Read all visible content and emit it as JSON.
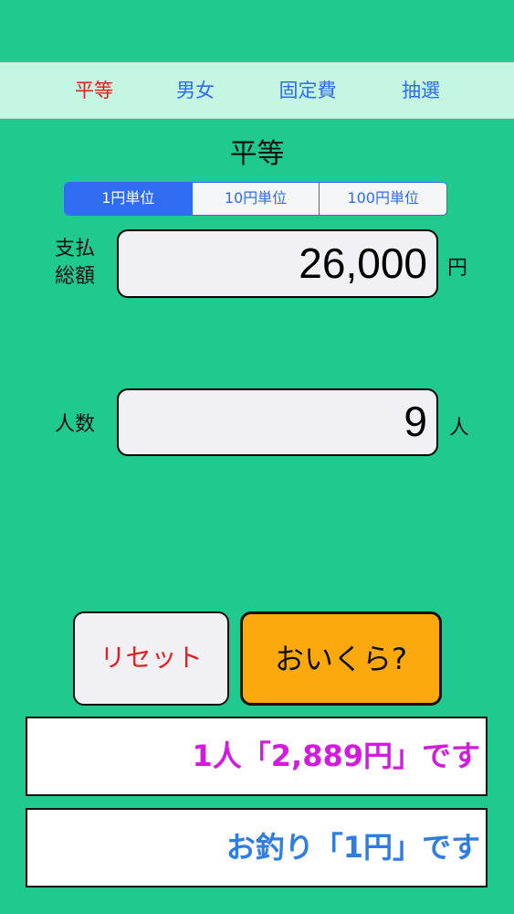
{
  "tabs": [
    {
      "label": "平等",
      "active": true
    },
    {
      "label": "男女",
      "active": false
    },
    {
      "label": "固定費",
      "active": false
    },
    {
      "label": "抽選",
      "active": false
    }
  ],
  "page_title": "平等",
  "unit_selector": {
    "options": [
      "1円単位",
      "10円単位",
      "100円単位"
    ],
    "selected": "1円単位"
  },
  "total": {
    "label_line1": "支払",
    "label_line2": "総額",
    "value": "26,000",
    "unit": "円"
  },
  "people": {
    "label": "人数",
    "value": "9",
    "unit": "人"
  },
  "buttons": {
    "reset": "リセット",
    "calculate": "おいくら?"
  },
  "results": {
    "per_person": "1人「2,889円」です",
    "change": "お釣り「1円」です"
  },
  "colors": {
    "background": "#20c98e",
    "tabbar": "#c4f6e2",
    "active_tab": "#e02020",
    "inactive_tab": "#2f6cf1",
    "calculate_button": "#fca90e",
    "reset_text": "#e02020",
    "per_person_text": "#d21cdc",
    "change_text": "#2f7de0"
  }
}
